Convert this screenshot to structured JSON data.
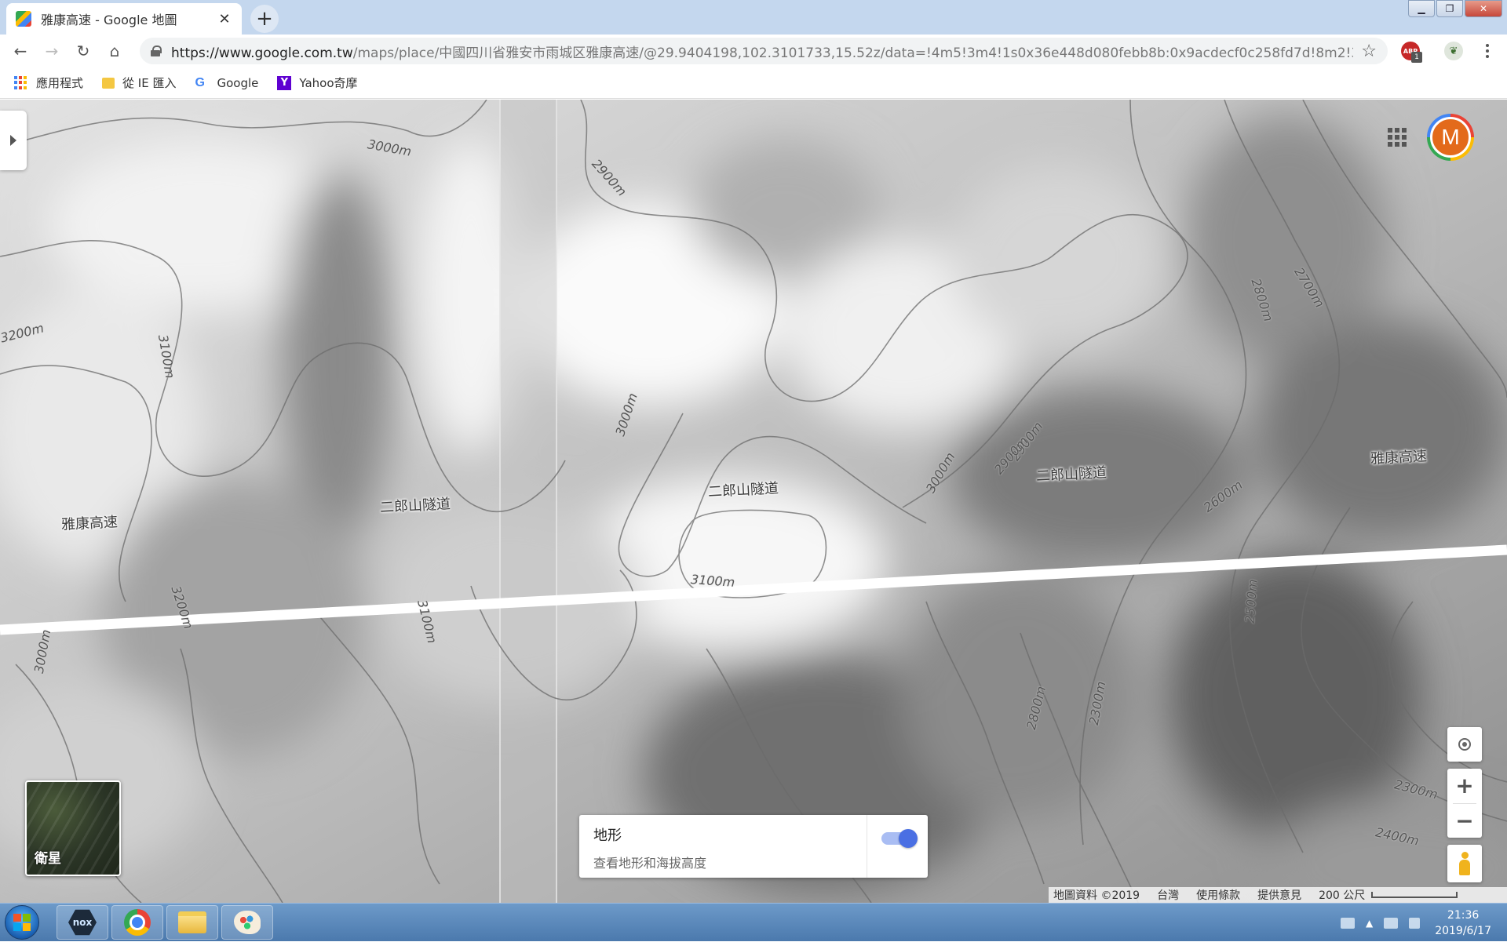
{
  "browser": {
    "tab_title": "雅康高速 - Google 地圖",
    "tab_close": "✕",
    "new_tab": "+",
    "url_host": "https://www.google.com.tw",
    "url_path": "/maps/place/中國四川省雅安市雨城区雅康高速/@29.9404198,102.3101733,15.52z/data=!4m5!3m4!1s0x36e448d080febb8b:0x9acdecf0c258fd7d!8m2!3d2...",
    "abp_label": "ABP",
    "abp_badge": "1"
  },
  "bookmarks": [
    {
      "label": "應用程式",
      "icon": "apps-icon"
    },
    {
      "label": "從 IE 匯入",
      "icon": "folder-icon"
    },
    {
      "label": "Google",
      "icon": "google-icon"
    },
    {
      "label": "Yahoo奇摩",
      "icon": "yahoo-icon"
    }
  ],
  "map": {
    "road_labels": [
      "雅康高速",
      "二郎山隧道",
      "二郎山隧道",
      "二郎山隧道",
      "雅康高速"
    ],
    "contour_labels": [
      "3000m",
      "2900m",
      "3200m",
      "3100m",
      "3000m",
      "2900m",
      "2800m",
      "2700m",
      "3000m",
      "2900m",
      "2600m",
      "3100m",
      "3200m",
      "3100m",
      "3000m",
      "2500m",
      "2800m",
      "2300m",
      "2300m",
      "2400m"
    ],
    "avatar_letter": "M",
    "satellite_label": "衛星",
    "terrain_card": {
      "title": "地形",
      "subtitle": "查看地形和海拔高度",
      "enabled": true
    },
    "zoom_in": "+",
    "zoom_out": "−",
    "footer": {
      "data": "地圖資料 ©2019",
      "region": "台灣",
      "terms": "使用條款",
      "feedback": "提供意見",
      "scale": "200 公尺"
    }
  },
  "taskbar": {
    "nox_label": "nox",
    "time": "21:36",
    "date": "2019/6/17"
  }
}
